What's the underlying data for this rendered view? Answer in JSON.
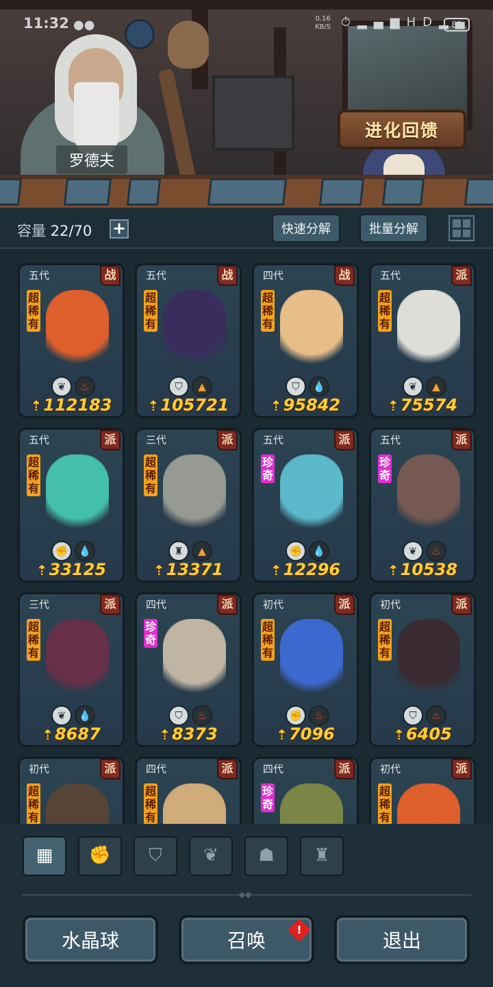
{
  "status_bar": {
    "time": "11:32",
    "network_speed": "0.16\nKB/S",
    "battery": "83",
    "icons": [
      "alarm-icon",
      "signal-4g-icon",
      "signal-icon",
      "hd-icon",
      "signal2-icon"
    ]
  },
  "header": {
    "npc_name": "罗德夫",
    "evolution_button": "进化回馈"
  },
  "toolbar": {
    "capacity_label": "容量",
    "capacity_value": "22/70",
    "add_button": "+",
    "quick_decompose": "快速分解",
    "batch_decompose": "批量分解"
  },
  "colors": {
    "epic_rarity": "#f2a21c",
    "rare_rarity": "#e12fd0",
    "power": "#ffcd3b",
    "class_badge": "#7f2a22"
  },
  "cards": [
    {
      "gen": "五代",
      "cls": "战",
      "rarity": "超稀有",
      "rarity_type": "sr",
      "power": "112183",
      "elements": [
        "leaf",
        "fire"
      ],
      "art_color": "#e8612a"
    },
    {
      "gen": "五代",
      "cls": "战",
      "rarity": "超稀有",
      "rarity_type": "sr",
      "power": "105721",
      "elements": [
        "shield",
        "earth"
      ],
      "art_color": "#3a2c5e"
    },
    {
      "gen": "四代",
      "cls": "战",
      "rarity": "超稀有",
      "rarity_type": "sr",
      "power": "95842",
      "elements": [
        "shield",
        "water"
      ],
      "art_color": "#f1c48a"
    },
    {
      "gen": "五代",
      "cls": "派",
      "rarity": "超稀有",
      "rarity_type": "sr",
      "power": "75574",
      "elements": [
        "leaf",
        "earth"
      ],
      "art_color": "#e8e6df"
    },
    {
      "gen": "五代",
      "cls": "派",
      "rarity": "超稀有",
      "rarity_type": "sr",
      "power": "33125",
      "elements": [
        "fist",
        "water"
      ],
      "art_color": "#46c6b0"
    },
    {
      "gen": "三代",
      "cls": "派",
      "rarity": "超稀有",
      "rarity_type": "sr",
      "power": "13371",
      "elements": [
        "tower",
        "earth"
      ],
      "art_color": "#9c9f96"
    },
    {
      "gen": "五代",
      "cls": "派",
      "rarity": "珍奇",
      "rarity_type": "rare",
      "power": "12296",
      "elements": [
        "fist",
        "water"
      ],
      "art_color": "#5fbfd1"
    },
    {
      "gen": "五代",
      "cls": "派",
      "rarity": "珍奇",
      "rarity_type": "rare",
      "power": "10538",
      "elements": [
        "leaf",
        "fire"
      ],
      "art_color": "#7a5a52"
    },
    {
      "gen": "三代",
      "cls": "派",
      "rarity": "超稀有",
      "rarity_type": "sr",
      "power": "8687",
      "elements": [
        "leaf",
        "water"
      ],
      "art_color": "#6a2f48"
    },
    {
      "gen": "四代",
      "cls": "派",
      "rarity": "珍奇",
      "rarity_type": "rare",
      "power": "8373",
      "elements": [
        "shield",
        "fire"
      ],
      "art_color": "#c8bba6"
    },
    {
      "gen": "初代",
      "cls": "派",
      "rarity": "超稀有",
      "rarity_type": "sr",
      "power": "7096",
      "elements": [
        "fist",
        "fire"
      ],
      "art_color": "#3d6bd6"
    },
    {
      "gen": "初代",
      "cls": "派",
      "rarity": "超稀有",
      "rarity_type": "sr",
      "power": "6405",
      "elements": [
        "shield",
        "fire"
      ],
      "art_color": "#3c2a30"
    },
    {
      "gen": "初代",
      "cls": "派",
      "rarity": "超稀有",
      "rarity_type": "sr",
      "power": "",
      "elements": [],
      "art_color": "#5a4536"
    },
    {
      "gen": "四代",
      "cls": "派",
      "rarity": "超稀有",
      "rarity_type": "sr",
      "power": "",
      "elements": [],
      "art_color": "#d8b27a"
    },
    {
      "gen": "四代",
      "cls": "派",
      "rarity": "珍奇",
      "rarity_type": "rare",
      "power": "",
      "elements": [],
      "art_color": "#7f8a46"
    },
    {
      "gen": "初代",
      "cls": "派",
      "rarity": "超稀有",
      "rarity_type": "sr",
      "power": "",
      "elements": [],
      "art_color": "#e8612a"
    }
  ],
  "filter_tabs": [
    {
      "name": "all-tab",
      "icon": "blocks-icon",
      "glyph": "▦",
      "active": true
    },
    {
      "name": "fist-tab",
      "icon": "fist-icon",
      "glyph": "✊",
      "active": false
    },
    {
      "name": "shield-tab",
      "icon": "shield-wings-icon",
      "glyph": "⛉",
      "active": false
    },
    {
      "name": "leaf-tab",
      "icon": "leaf-icon",
      "glyph": "❦",
      "active": false
    },
    {
      "name": "alien-tab",
      "icon": "alien-head-icon",
      "glyph": "☗",
      "active": false
    },
    {
      "name": "tower-tab",
      "icon": "tower-icon",
      "glyph": "♜",
      "active": false
    }
  ],
  "bottom_buttons": {
    "crystal_ball": "水晶球",
    "summon": "召唤",
    "exit": "退出",
    "summon_alert": "!"
  }
}
